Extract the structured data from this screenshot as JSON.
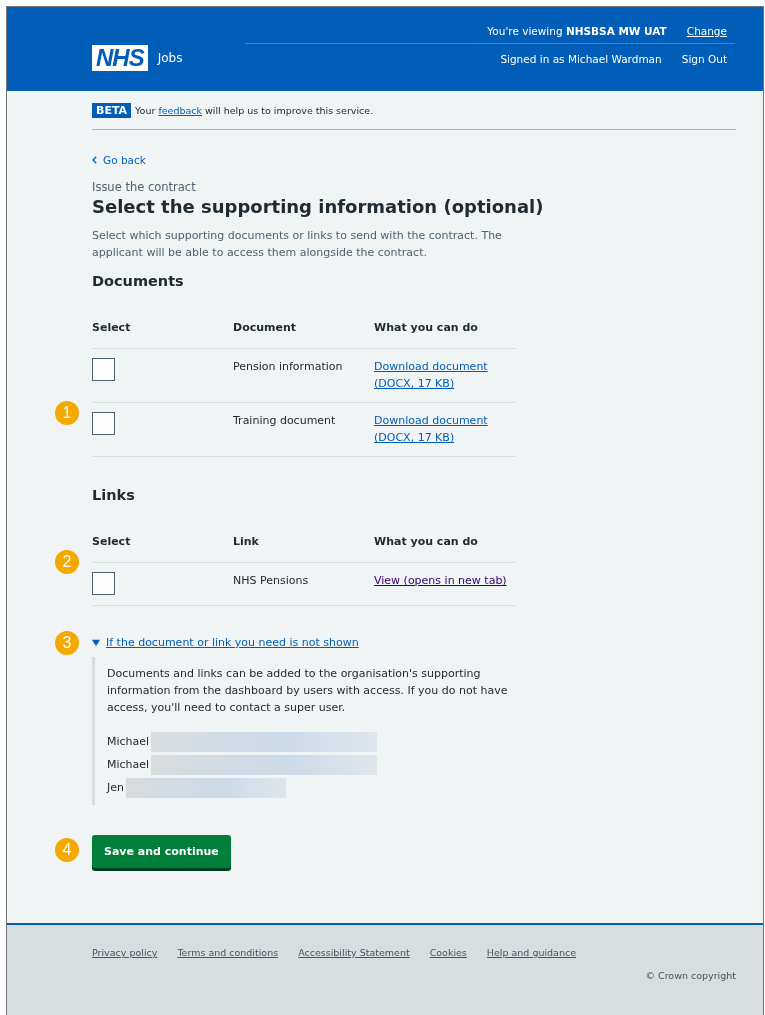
{
  "header": {
    "logo": "NHS",
    "service": "Jobs",
    "viewing_prefix": "You're viewing ",
    "viewing_org": "NHSBSA MW UAT",
    "change_link": "Change",
    "signed_in": "Signed in as Michael Wardman",
    "sign_out": "Sign Out"
  },
  "beta": {
    "tag": "BETA",
    "before": "Your ",
    "link": "feedback",
    "after": " will help us to improve this service."
  },
  "back_link": "Go back",
  "caption": "Issue the contract",
  "title": "Select the supporting information (optional)",
  "intro": "Select which supporting documents or links to send with the contract. The applicant will be able to access them alongside the contract.",
  "sections": [
    {
      "heading": "Documents",
      "callout": "1",
      "columns": [
        "Select",
        "Document",
        "What you can do"
      ],
      "rows": [
        {
          "checked": false,
          "name": "Pension information",
          "action": "Download document (DOCX, 17 KB)",
          "visited": false
        },
        {
          "checked": false,
          "name": "Training document",
          "action": "Download document (DOCX, 17 KB)",
          "visited": false
        }
      ]
    },
    {
      "heading": "Links",
      "callout": "2",
      "columns": [
        "Select",
        "Link",
        "What you can do"
      ],
      "rows": [
        {
          "checked": false,
          "name": "NHS Pensions",
          "action": "View (opens in new tab)",
          "visited": true
        }
      ]
    }
  ],
  "details": {
    "callout": "3",
    "summary": "If the document or link you need is not shown",
    "expanded": true,
    "text": "Documents and links can be added to the organisation's supporting information from the dashboard by users with access. If you do not have access, you'll need to contact a super user.",
    "contacts": [
      {
        "name": "Michael",
        "redacted": true
      },
      {
        "name": "Michael",
        "redacted": true
      },
      {
        "name": "Jen",
        "redacted": true
      }
    ]
  },
  "button": {
    "label": "Save and continue",
    "callout": "4"
  },
  "footer": {
    "links": [
      "Privacy policy",
      "Terms and conditions",
      "Accessibility Statement",
      "Cookies",
      "Help and guidance"
    ],
    "copyright": "© Crown copyright"
  }
}
